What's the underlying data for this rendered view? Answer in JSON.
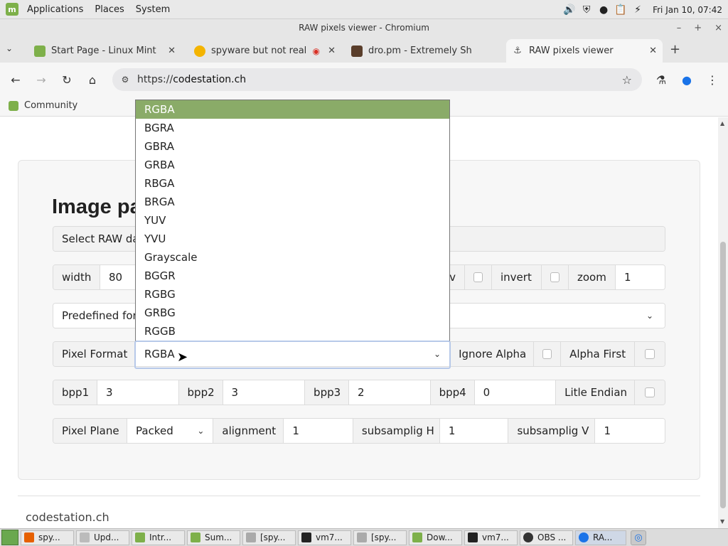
{
  "system_panel": {
    "menus": [
      "Applications",
      "Places",
      "System"
    ],
    "clock": "Fri Jan 10, 07:42"
  },
  "window": {
    "title": "RAW pixels viewer - Chromium"
  },
  "tabs": [
    {
      "title": "Start Page - Linux Mint",
      "favicon_color": "#7eb04a"
    },
    {
      "title": "spyware but not really",
      "favicon_color": "#f4b400"
    },
    {
      "title": "dro.pm - Extremely Short",
      "favicon_color": "#5a3e2b"
    },
    {
      "title": "RAW pixels viewer",
      "favicon_color": "#ffffff",
      "active": true
    }
  ],
  "toolbar": {
    "url_scheme": "https://",
    "url_host": "codestation.ch"
  },
  "bookmarks": [
    {
      "label": "Community"
    }
  ],
  "page": {
    "heading": "Image pa",
    "select_raw_label": "Select RAW da",
    "row_size": {
      "width_label": "width",
      "width_value": "80",
      "hidden_label_tail": "v",
      "invert_label": "invert",
      "zoom_label": "zoom",
      "zoom_value": "1"
    },
    "predefined_label": "Predefined for",
    "row_format": {
      "pixel_format_label": "Pixel Format",
      "pixel_format_value": "RGBA",
      "ignore_alpha_label": "Ignore Alpha",
      "alpha_first_label": "Alpha First"
    },
    "row_bpp": {
      "bpp1_label": "bpp1",
      "bpp1_value": "3",
      "bpp2_label": "bpp2",
      "bpp2_value": "3",
      "bpp3_label": "bpp3",
      "bpp3_value": "2",
      "bpp4_label": "bpp4",
      "bpp4_value": "0",
      "endian_label": "Litle Endian"
    },
    "row_plane": {
      "pixel_plane_label": "Pixel Plane",
      "pixel_plane_value": "Packed",
      "alignment_label": "alignment",
      "alignment_value": "1",
      "subsampling_h_label": "subsamplig H",
      "subsampling_h_value": "1",
      "subsampling_v_label": "subsamplig V",
      "subsampling_v_value": "1"
    },
    "footer": "codestation.ch"
  },
  "dropdown": {
    "options": [
      "RGBA",
      "BGRA",
      "GBRA",
      "GRBA",
      "RBGA",
      "BRGA",
      "YUV",
      "YVU",
      "Grayscale",
      "BGGR",
      "RGBG",
      "GRBG",
      "RGGB"
    ],
    "selected": "RGBA",
    "highlight_color": "#8aab68"
  },
  "taskbar": {
    "items": [
      "spy...",
      "Upd...",
      "Intr...",
      "Sum...",
      "[spy...",
      "vm7...",
      "[spy...",
      "Dow...",
      "vm7...",
      "OBS ...",
      "RA..."
    ]
  }
}
